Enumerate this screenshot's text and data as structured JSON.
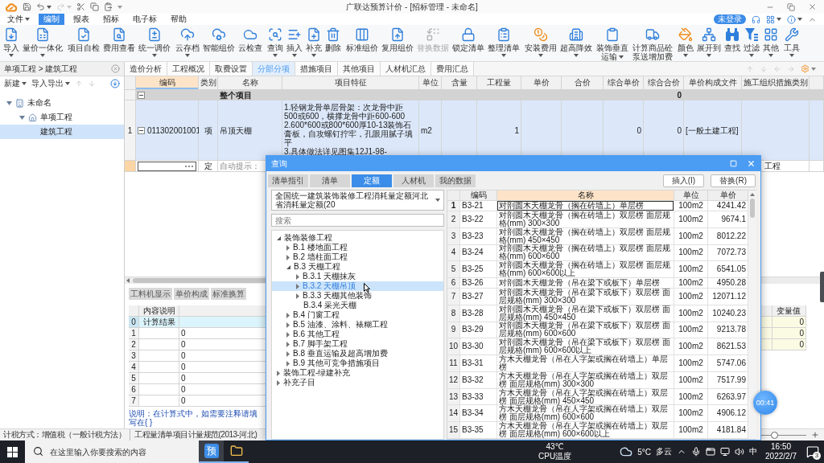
{
  "window": {
    "title": "广联达预算计价 - [招标管理 - 未命名]"
  },
  "quick_access": [
    {
      "disabled": false
    },
    {
      "disabled": false
    },
    {
      "disabled": true
    },
    {
      "disabled": false
    },
    {
      "disabled": false
    },
    {
      "disabled": false
    }
  ],
  "menu": [
    {
      "label": "文件",
      "caret": true,
      "selected": false
    },
    {
      "label": "编制",
      "caret": false,
      "selected": true
    },
    {
      "label": "报表",
      "caret": false,
      "selected": false
    },
    {
      "label": "招标",
      "caret": false,
      "selected": false
    },
    {
      "label": "电子标",
      "caret": false,
      "selected": false
    },
    {
      "label": "帮助",
      "caret": false,
      "selected": false
    }
  ],
  "account": {
    "status": "未登录"
  },
  "ribbon": {
    "groups": [
      [
        {
          "label": "导入",
          "caret": true,
          "disabled": false
        },
        {
          "label": "量价一体化",
          "caret": true,
          "disabled": false
        }
      ],
      [
        {
          "label": "项目自检",
          "caret": false,
          "disabled": false
        },
        {
          "label": "费用查看",
          "caret": false,
          "disabled": false
        },
        {
          "label": "统一调价",
          "caret": true,
          "disabled": false
        }
      ],
      [
        {
          "label": "云存档",
          "caret": true,
          "disabled": false
        },
        {
          "label": "智能组价",
          "caret": false,
          "disabled": false
        },
        {
          "label": "云检查",
          "caret": false,
          "disabled": false
        }
      ],
      [
        {
          "label": "查询",
          "caret": true,
          "disabled": false
        },
        {
          "label": "插入",
          "caret": true,
          "disabled": false
        },
        {
          "label": "补充",
          "caret": true,
          "disabled": false
        },
        {
          "label": "删除",
          "caret": false,
          "disabled": false
        }
      ],
      [
        {
          "label": "标准组价",
          "caret": false,
          "disabled": false
        },
        {
          "label": "复用组价",
          "caret": false,
          "disabled": false
        },
        {
          "label": "替换数据",
          "caret": false,
          "disabled": true
        },
        {
          "label": "锁定清单",
          "caret": false,
          "disabled": false
        },
        {
          "label": "整理清单",
          "caret": true,
          "disabled": false
        }
      ],
      [
        {
          "label": "安装费用",
          "caret": true,
          "disabled": false
        },
        {
          "label": "超高降效",
          "caret": true,
          "disabled": false
        },
        {
          "label": "装饰垂直运输",
          "caret": true,
          "disabled": false
        },
        {
          "label": "计算商品砼泵送增加费",
          "caret": false,
          "disabled": false
        }
      ],
      [
        {
          "label": "颜色",
          "caret": true,
          "disabled": false
        },
        {
          "label": "展开到",
          "caret": true,
          "disabled": false
        },
        {
          "label": "查找",
          "caret": false,
          "disabled": false
        },
        {
          "label": "过滤",
          "caret": true,
          "disabled": false
        },
        {
          "label": "其他",
          "caret": true,
          "disabled": false
        }
      ],
      [
        {
          "label": "工具",
          "caret": true,
          "disabled": false
        }
      ]
    ]
  },
  "project_panel": {
    "breadcrumb": "单项工程 > 建筑工程",
    "actions": [
      {
        "label": "新建",
        "caret": true
      },
      {
        "label": "导入导出",
        "caret": true
      }
    ],
    "move_buttons": [
      {
        "disabled": true
      },
      {
        "disabled": true
      }
    ],
    "tree": [
      {
        "label": "未命名",
        "expanded": true,
        "selected": false,
        "children": [
          {
            "label": "单项工程",
            "expanded": true,
            "selected": false,
            "children": [
              {
                "label": "建筑工程",
                "selected": true
              }
            ]
          }
        ]
      }
    ]
  },
  "tabs": [
    {
      "label": "造价分析",
      "selected": false
    },
    {
      "label": "工程概况",
      "selected": false
    },
    {
      "label": "取费设置",
      "selected": false
    },
    {
      "label": "分部分项",
      "selected": true
    },
    {
      "label": "措施项目",
      "selected": false
    },
    {
      "label": "其他项目",
      "selected": false
    },
    {
      "label": "人材机汇总",
      "selected": false
    },
    {
      "label": "费用汇总",
      "selected": false
    }
  ],
  "tab_tools": {
    "arrows": [
      {
        "disabled": true
      },
      {
        "disabled": true
      },
      {
        "disabled": true
      },
      {
        "disabled": true
      }
    ]
  },
  "table": {
    "columns": [
      {
        "label": "编码",
        "selected": true
      },
      {
        "label": "类别",
        "selected": false
      },
      {
        "label": "名称",
        "selected": false
      },
      {
        "label": "项目特征",
        "selected": false
      },
      {
        "label": "单位",
        "selected": false
      },
      {
        "label": "含量",
        "selected": false
      },
      {
        "label": "工程量",
        "selected": false
      },
      {
        "label": "单价",
        "selected": false
      },
      {
        "label": "合价",
        "selected": false
      },
      {
        "label": "综合单价",
        "selected": false
      },
      {
        "label": "综合合价",
        "selected": false
      },
      {
        "label": "单价构成文件",
        "selected": false
      },
      {
        "label": "施工组织措施类别",
        "selected": false
      }
    ],
    "rows": [
      {
        "kind": "group",
        "selected": false,
        "expanded": true,
        "cells": {
          "name": "整个项目",
          "composite_total": "0"
        }
      },
      {
        "kind": "item",
        "number": "1",
        "selected": false,
        "expanded": true,
        "cells": {
          "code": "011302001001",
          "type": "项",
          "name": "吊顶天棚",
          "features": "1.轻钢龙骨单层骨架：次龙骨中距500或600，横撑龙骨中距600-600\n2.600*600或800*600厚10-13装饰石膏板，自攻螺钉拧牢，孔眼用腻子填平\n3.具体做法详见图集12J1-98-",
          "unit": "m2",
          "quantity": "1",
          "composite_unit_price": "0",
          "composite_total": "0",
          "price_file": "[一般土建工程]"
        }
      },
      {
        "kind": "entry",
        "selected": true,
        "cells": {
          "type": "定",
          "name": "自动提示：",
          "measure_category": "工程"
        }
      }
    ]
  },
  "detail": {
    "tabs": [
      {
        "label": "工料机显示",
        "selected": false
      },
      {
        "label": "单价构成",
        "selected": false
      },
      {
        "label": "标准换算",
        "selected": false
      }
    ],
    "formula_table": {
      "columns": [
        "内容说明"
      ],
      "rows": [
        {
          "number": "0",
          "label": "计算结果",
          "selected": true
        },
        {
          "number": "1",
          "value": "0",
          "selected": false
        },
        {
          "number": "2",
          "value": "0",
          "selected": false
        },
        {
          "number": "3",
          "value": "0",
          "selected": false
        },
        {
          "number": "4",
          "value": "0",
          "selected": false
        },
        {
          "number": "5",
          "value": "0",
          "selected": false
        },
        {
          "number": "6",
          "value": "0",
          "selected": false
        },
        {
          "number": "7",
          "value": "0",
          "selected": false
        }
      ]
    },
    "note": "说明：在计算式中，如需要注释请填写在{ }",
    "variables": {
      "columns": [
        "变量值"
      ],
      "rows": [
        "0",
        "0",
        "0"
      ]
    }
  },
  "status_bar": {
    "items": [
      "计税方式：增值税（一般计税方法）",
      "工程量清单项目计量规范(2013-河北)"
    ],
    "zoom_slider": {
      "level": 0.25
    }
  },
  "dialog": {
    "title": "查询",
    "tabs": [
      {
        "label": "清单指引",
        "selected": false
      },
      {
        "label": "清单",
        "selected": false
      },
      {
        "label": "定额",
        "selected": true
      },
      {
        "label": "人材机",
        "selected": false
      },
      {
        "label": "我的数据",
        "selected": false
      }
    ],
    "buttons": [
      "插入(I)",
      "替换(R)"
    ],
    "library": "全国统一建筑装饰装修工程消耗量定额河北省消耗量定额(20",
    "search": {
      "placeholder": "搜索"
    },
    "tree": [
      {
        "label": "装饰装修工程",
        "expanded": true,
        "selected": false,
        "children": [
          {
            "label": "B.1 楼地面工程",
            "expanded": false,
            "selected": false
          },
          {
            "label": "B.2 墙柱面工程",
            "expanded": false,
            "selected": false
          },
          {
            "label": "B.3 天棚工程",
            "expanded": true,
            "selected": false,
            "children": [
              {
                "label": "B.3.1 天棚抹灰",
                "expanded": false,
                "selected": false
              },
              {
                "label": "B.3.2 天棚吊顶",
                "expanded": false,
                "selected": true
              },
              {
                "label": "B.3.3 天棚其他装饰",
                "expanded": false,
                "selected": false
              },
              {
                "label": "B.3.4 采光天棚",
                "selected": false
              }
            ]
          },
          {
            "label": "B.4 门窗工程",
            "expanded": false,
            "selected": false
          },
          {
            "label": "B.5 油漆、涂料、裱糊工程",
            "expanded": false,
            "selected": false
          },
          {
            "label": "B.6 其他工程",
            "expanded": false,
            "selected": false
          },
          {
            "label": "B.7 脚手架工程",
            "expanded": false,
            "selected": false
          },
          {
            "label": "B.8 垂直运输及超高增加费",
            "expanded": false,
            "selected": false
          },
          {
            "label": "B.9 其他可竞争措施项目",
            "expanded": false,
            "selected": false
          }
        ]
      },
      {
        "label": "装饰工程-绿建补充",
        "expanded": false,
        "selected": false
      },
      {
        "label": "补充子目",
        "expanded": false,
        "selected": false
      }
    ],
    "table": {
      "columns": [
        {
          "label": "编码",
          "selected": false
        },
        {
          "label": "名称",
          "selected": true
        },
        {
          "label": "单位",
          "selected": false
        },
        {
          "label": "单价",
          "selected": false
        }
      ],
      "rows": [
        {
          "number": "1",
          "selected": true,
          "code": "B3-21",
          "name": "对剖圆木天棚龙骨（搁在砖墙上）单层楞",
          "unit": "100m2",
          "price": "4241.42"
        },
        {
          "number": "2",
          "selected": false,
          "code": "B3-22",
          "name": "对剖圆木天棚龙骨（搁在砖墙上）双层楞 面层规格(mm) 300×300",
          "unit": "100m2",
          "price": "9674.1"
        },
        {
          "number": "3",
          "selected": false,
          "code": "B3-23",
          "name": "对剖圆木天棚龙骨（搁在砖墙上）双层楞 面层规格(mm) 450×450",
          "unit": "100m2",
          "price": "8012.22"
        },
        {
          "number": "4",
          "selected": false,
          "code": "B3-24",
          "name": "对剖圆木天棚龙骨（搁在砖墙上）双层楞 面层规格(mm) 600×600",
          "unit": "100m2",
          "price": "7072.73"
        },
        {
          "number": "5",
          "selected": false,
          "code": "B3-25",
          "name": "对剖圆木天棚龙骨（搁在砖墙上）双层楞 面层规格(mm) 600×600以上",
          "unit": "100m2",
          "price": "6541.05"
        },
        {
          "number": "6",
          "selected": false,
          "code": "B3-26",
          "name": "对剖圆木天棚龙骨（吊在梁下或板下）单层楞",
          "unit": "100m2",
          "price": "4950.28"
        },
        {
          "number": "7",
          "selected": false,
          "code": "B3-27",
          "name": "对剖圆木天棚龙骨（吊在梁下或板下）双层楞 面层规格(mm) 300×300",
          "unit": "100m2",
          "price": "12071.12"
        },
        {
          "number": "8",
          "selected": false,
          "code": "B3-28",
          "name": "对剖圆木天棚龙骨（吊在梁下或板下）双层楞 面层规格(mm) 450×450",
          "unit": "100m2",
          "price": "10240.23"
        },
        {
          "number": "9",
          "selected": false,
          "code": "B3-29",
          "name": "对剖圆木天棚龙骨（吊在梁下或板下）双层楞 面层规格(mm) 600×600",
          "unit": "100m2",
          "price": "9213.78"
        },
        {
          "number": "10",
          "selected": false,
          "code": "B3-30",
          "name": "对剖圆木天棚龙骨（吊在梁下或板下）双层楞 面层规格(mm) 600×600以上",
          "unit": "100m2",
          "price": "8621.53"
        },
        {
          "number": "11",
          "selected": false,
          "code": "B3-31",
          "name": "方木天棚龙骨（吊在人字架或搁在砖墙上）单层楞",
          "unit": "100m2",
          "price": "5747.06"
        },
        {
          "number": "12",
          "selected": false,
          "code": "B3-32",
          "name": "方木天棚龙骨（吊在人字架或搁在砖墙上）双层楞 面层规格(mm) 300×300",
          "unit": "100m2",
          "price": "7517.99"
        },
        {
          "number": "13",
          "selected": false,
          "code": "B3-33",
          "name": "方木天棚龙骨（吊在人字架或搁在砖墙上）双层楞 面层规格(mm) 450×450",
          "unit": "100m2",
          "price": "6263.97"
        },
        {
          "number": "14",
          "selected": false,
          "code": "B3-34",
          "name": "方木天棚龙骨（吊在人字架或搁在砖墙上）双层楞 面层规格(mm) 600×600",
          "unit": "100m2",
          "price": "4906.12"
        },
        {
          "number": "15",
          "selected": false,
          "code": "B3-35",
          "name": "方木天棚龙骨（吊在人字架或搁在砖墙上）双层楞 面层规格(mm) 600×600以上",
          "unit": "100m2",
          "price": "4181.84"
        }
      ]
    }
  },
  "taskbar": {
    "search": {
      "placeholder": "在这里输入你要搜索的内容"
    },
    "apps": [
      {
        "kind": "text-tile",
        "label": "预",
        "selected": true
      },
      {
        "kind": "folder",
        "selected": false
      }
    ],
    "cpu": {
      "value": "43℃",
      "label": "CPU温度"
    },
    "weather": {
      "temperature": "5°C",
      "condition": "多云"
    },
    "input_method": "中",
    "clock": {
      "time": "16:50",
      "date": "2022/2/7"
    },
    "notifications": "3"
  },
  "timer": "00:41"
}
